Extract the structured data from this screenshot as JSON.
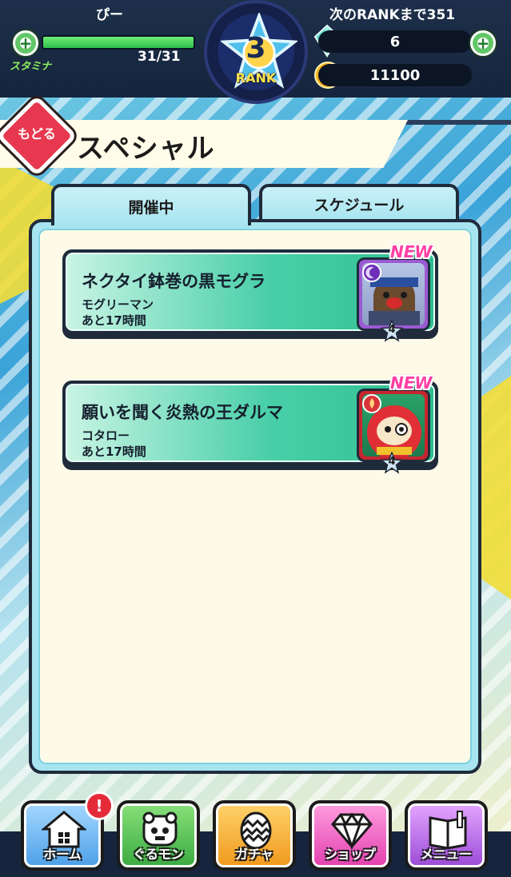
{
  "status": {
    "username": "ぴー",
    "next_rank": "次のRANKまで351",
    "stamina_label": "スタミナ",
    "stamina_value": "31/31",
    "stamina_fraction": 1.0,
    "rank_number": "3",
    "rank_label": "RANK",
    "gems": "6",
    "coins": "11100"
  },
  "header": {
    "back_label": "もどる",
    "title": "スペシャル"
  },
  "tabs": [
    {
      "label": "開催中",
      "active": true
    },
    {
      "label": "スケジュール",
      "active": false
    }
  ],
  "events": [
    {
      "title": "ネクタイ鉢巻の黒モグラ",
      "monster": "モグリーマン",
      "remaining": "あと17時間",
      "badge": "NEW",
      "rank": "4",
      "portrait_icon": "mole-monster-icon"
    },
    {
      "title": "願いを聞く炎熱の王ダルマ",
      "monster": "コタロー",
      "remaining": "あと17時間",
      "badge": "NEW",
      "rank": "4",
      "portrait_icon": "daruma-monster-icon"
    }
  ],
  "nav": {
    "home": "ホーム",
    "gurumon": "ぐるモン",
    "gacha": "ガチャ",
    "shop": "ショップ",
    "menu": "メニュー",
    "home_alert": "!"
  },
  "colors": {
    "accent_green": "#2ec08f",
    "back_red": "#e8384f",
    "new_pink": "#ff3fa4",
    "rank_yellow": "#ffe34b"
  }
}
